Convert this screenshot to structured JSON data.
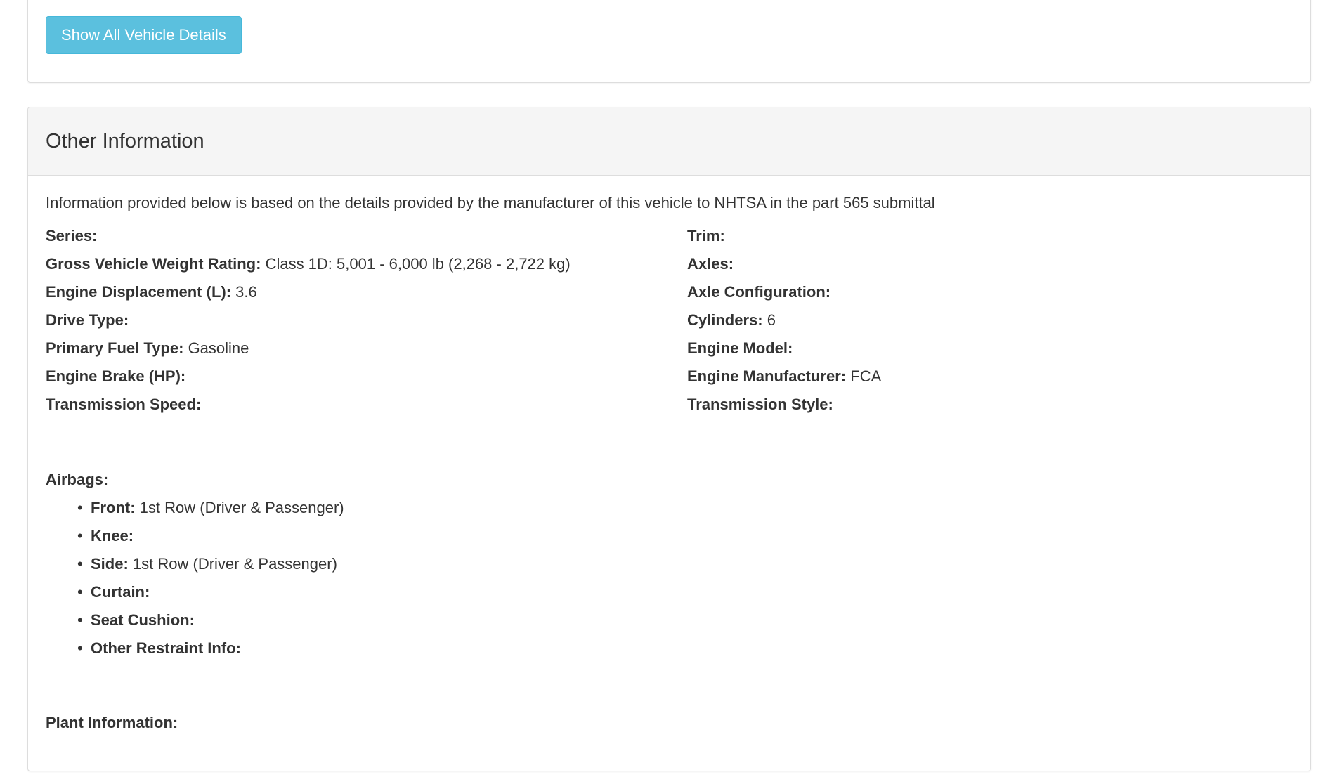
{
  "actions": {
    "show_all_label": "Show All Vehicle Details"
  },
  "other_info": {
    "title": "Other Information",
    "intro": "Information provided below is based on the details provided by the manufacturer of this vehicle to NHTSA in the part 565 submittal",
    "left_specs": [
      {
        "label": "Series:",
        "value": ""
      },
      {
        "label": "Gross Vehicle Weight Rating:",
        "value": "Class 1D: 5,001 - 6,000 lb (2,268 - 2,722 kg)"
      },
      {
        "label": "Engine Displacement (L):",
        "value": "3.6"
      },
      {
        "label": "Drive Type:",
        "value": ""
      },
      {
        "label": "Primary Fuel Type:",
        "value": "Gasoline"
      },
      {
        "label": "Engine Brake (HP):",
        "value": ""
      },
      {
        "label": "Transmission Speed:",
        "value": ""
      }
    ],
    "right_specs": [
      {
        "label": "Trim:",
        "value": ""
      },
      {
        "label": "Axles:",
        "value": ""
      },
      {
        "label": "Axle Configuration:",
        "value": ""
      },
      {
        "label": "Cylinders:",
        "value": "6"
      },
      {
        "label": "Engine Model:",
        "value": ""
      },
      {
        "label": "Engine Manufacturer:",
        "value": "FCA"
      },
      {
        "label": "Transmission Style:",
        "value": ""
      }
    ],
    "airbags": {
      "title": "Airbags:",
      "items": [
        {
          "label": "Front:",
          "value": "1st Row (Driver & Passenger)"
        },
        {
          "label": "Knee:",
          "value": ""
        },
        {
          "label": "Side:",
          "value": "1st Row (Driver & Passenger)"
        },
        {
          "label": "Curtain:",
          "value": ""
        },
        {
          "label": "Seat Cushion:",
          "value": ""
        },
        {
          "label": "Other Restraint Info:",
          "value": ""
        }
      ]
    },
    "plant_label": "Plant Information:"
  },
  "colors": {
    "button_bg": "#5bc0de",
    "panel_heading_bg": "#f5f5f5",
    "text": "#333333"
  }
}
